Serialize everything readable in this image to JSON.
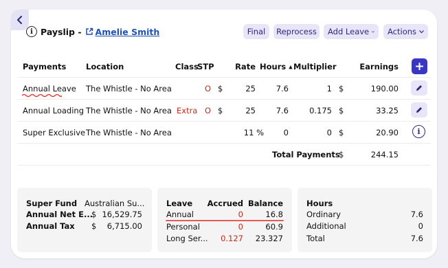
{
  "header": {
    "title": "Payslip -",
    "employee_name": "Amelie Smith"
  },
  "toolbar": {
    "final_label": "Final",
    "reprocess_label": "Reprocess",
    "add_leave_label": "Add Leave",
    "actions_label": "Actions"
  },
  "table": {
    "columns": {
      "payments": "Payments",
      "location": "Location",
      "class": "Class",
      "stp": "STP",
      "rate": "Rate",
      "hours": "Hours",
      "multiplier": "Multiplier",
      "earnings": "Earnings"
    },
    "rows": [
      {
        "payment": "Annual Leave",
        "location": "The Whistle - No Area",
        "class": "",
        "stp": "O",
        "rate_currency": "$",
        "rate": "25",
        "hours": "7.6",
        "multiplier": "1",
        "earn_currency": "$",
        "earnings": "190.00"
      },
      {
        "payment": "Annual Loading",
        "location": "The Whistle - No Area",
        "class": "Extra",
        "stp": "O",
        "rate_currency": "$",
        "rate": "25",
        "hours": "7.6",
        "multiplier": "0.175",
        "earn_currency": "$",
        "earnings": "33.25"
      },
      {
        "payment": "Super Exclusive",
        "location": "The Whistle - No Area",
        "class": "",
        "stp": "",
        "rate_currency": "",
        "rate": "11 %",
        "hours": "0",
        "multiplier": "0",
        "earn_currency": "$",
        "earnings": "20.90"
      }
    ],
    "total_label": "Total Payments",
    "total_currency": "$",
    "total_value": "244.15"
  },
  "super_panel": {
    "fund_label": "Super Fund",
    "fund_value": "Australian Su...",
    "net_label": "Annual Net E...",
    "net_currency": "$",
    "net_value": "16,529.75",
    "tax_label": "Annual Tax",
    "tax_currency": "$",
    "tax_value": "6,715.00"
  },
  "leave_panel": {
    "col_leave": "Leave",
    "col_accrued": "Accrued",
    "col_balance": "Balance",
    "rows": [
      {
        "name": "Annual",
        "accrued": "0",
        "balance": "16.8"
      },
      {
        "name": "Personal",
        "accrued": "0",
        "balance": "60.9"
      },
      {
        "name": "Long Ser...",
        "accrued": "0.127",
        "balance": "23.327"
      }
    ]
  },
  "hours_panel": {
    "title": "Hours",
    "rows": [
      {
        "name": "Ordinary",
        "value": "7.6"
      },
      {
        "name": "Additional",
        "value": "0"
      },
      {
        "name": "Total",
        "value": "7.6"
      }
    ]
  },
  "colors": {
    "accent": "#3a36c4",
    "button_bg": "#e7e5f7",
    "button_text": "#2b2882",
    "warning_red": "#c62a18",
    "link": "#1e52b4"
  },
  "icons": {
    "back": "chevron-left-icon",
    "info": "info-icon",
    "external_link": "external-link-icon",
    "dropdown": "chevron-down-icon",
    "sort": "sort-up-icon",
    "add": "plus-icon",
    "edit": "pencil-icon"
  }
}
